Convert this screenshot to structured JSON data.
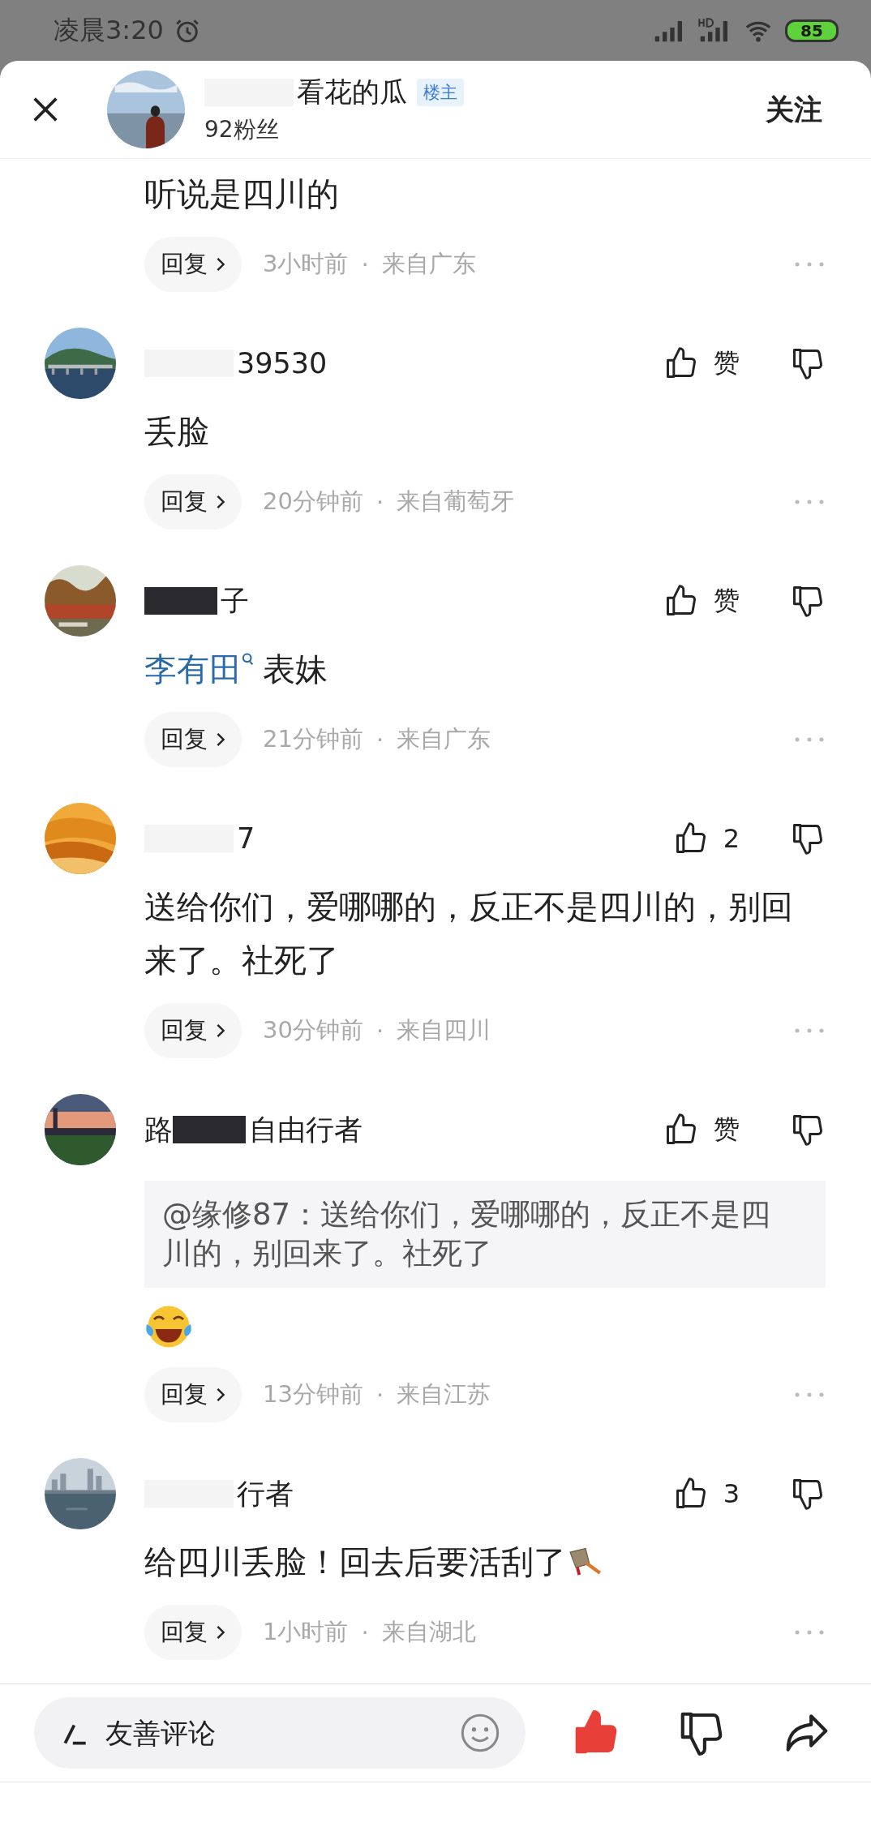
{
  "status_bar": {
    "time": "凌晨3:20",
    "battery": "85"
  },
  "header": {
    "author_name": "看花的瓜",
    "badge": "楼主",
    "followers": "92粉丝",
    "follow_button": "关注"
  },
  "comments": [
    {
      "kind": "partial",
      "text": "听说是四川的",
      "reply": "回复",
      "time": "3小时前",
      "separator": "·",
      "location": "来自广东"
    },
    {
      "kind": "full",
      "redaction": {
        "kind": "light"
      },
      "name": "39530",
      "likes": "赞",
      "text": "丢脸",
      "reply": "回复",
      "time": "20分钟前",
      "separator": "·",
      "location": "来自葡萄牙"
    },
    {
      "kind": "full",
      "redaction": {
        "kind": "dark"
      },
      "name": "子",
      "likes": "赞",
      "mention": "李有田",
      "text": "表妹",
      "reply": "回复",
      "time": "21分钟前",
      "separator": "·",
      "location": "来自广东"
    },
    {
      "kind": "full",
      "redaction": {
        "kind": "light"
      },
      "name": "7",
      "likes": "2",
      "text": "送给你们，爱哪哪的，反正不是四川的，别回来了。社死了",
      "reply": "回复",
      "time": "30分钟前",
      "separator": "·",
      "location": "来自四川"
    },
    {
      "kind": "full",
      "redaction": {
        "kind": "dark"
      },
      "name_prefix": "路",
      "name": "自由行者",
      "likes": "赞",
      "quote": "@缘修87：送给你们，爱哪哪的，反正不是四川的，别回来了。社死了",
      "emoji": {
        "kind": "laughing"
      },
      "reply": "回复",
      "time": "13分钟前",
      "separator": "·",
      "location": "来自江苏"
    },
    {
      "kind": "full",
      "redaction": {
        "kind": "light"
      },
      "name": "行者",
      "likes": "3",
      "text": "给四川丢脸！回去后要活刮了",
      "emoji": {
        "kind": "cleaver"
      },
      "reply": "回复",
      "time": "1小时前",
      "separator": "·",
      "location": "来自湖北"
    }
  ],
  "bottom_bar": {
    "placeholder": "友善评论",
    "liked": true
  }
}
